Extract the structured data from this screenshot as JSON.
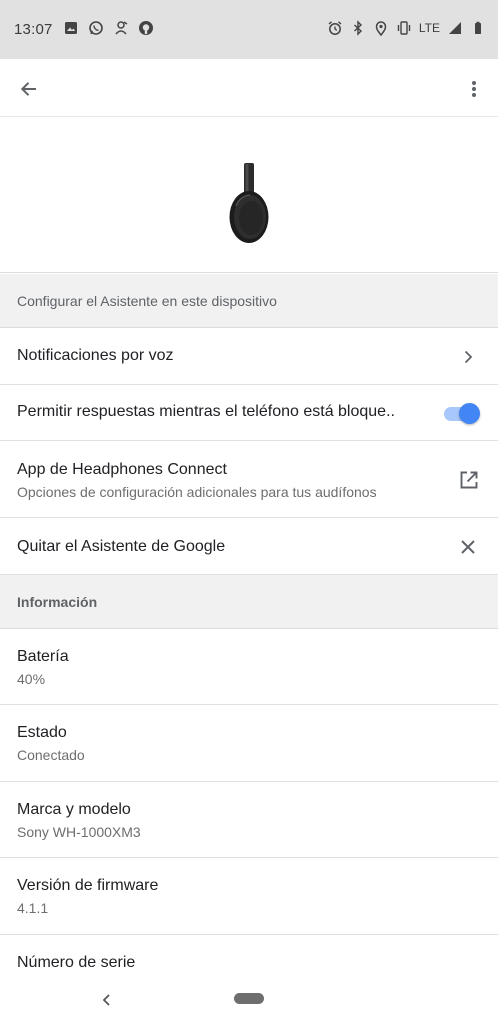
{
  "status_bar": {
    "time": "13:07",
    "network": "LTE",
    "left_icons": [
      "image-icon",
      "whatsapp-icon",
      "sync-icon",
      "github-icon"
    ],
    "right_icons": [
      "alarm-icon",
      "bluetooth-icon",
      "location-icon",
      "vibrate-icon",
      "signal-icon",
      "battery-icon"
    ]
  },
  "appbar": {
    "back_icon": "arrow-back-icon",
    "menu_icon": "more-vert-icon"
  },
  "assistant_section": {
    "header": "Configurar el Asistente en este dispositivo",
    "items": [
      {
        "title": "Notificaciones por voz",
        "trail": "chevron-right-icon"
      },
      {
        "title": "Permitir respuestas mientras el teléfono está bloque..",
        "toggle_on": true
      },
      {
        "title": "App de Headphones Connect",
        "subtitle": "Opciones de configuración adicionales para tus audífonos",
        "trail": "open-external-icon"
      },
      {
        "title": "Quitar el Asistente de Google",
        "trail": "close-icon"
      }
    ]
  },
  "info_section": {
    "header": "Información",
    "items": [
      {
        "title": "Batería",
        "value": "40%"
      },
      {
        "title": "Estado",
        "value": "Conectado"
      },
      {
        "title": "Marca y modelo",
        "value": "Sony WH-1000XM3"
      },
      {
        "title": "Versión de firmware",
        "value": "4.1.1"
      },
      {
        "title": "Número de serie"
      }
    ]
  },
  "colors": {
    "accent": "#4285f4",
    "status_bar": "#e1e1e1",
    "section_bg": "#f1f1f1"
  }
}
